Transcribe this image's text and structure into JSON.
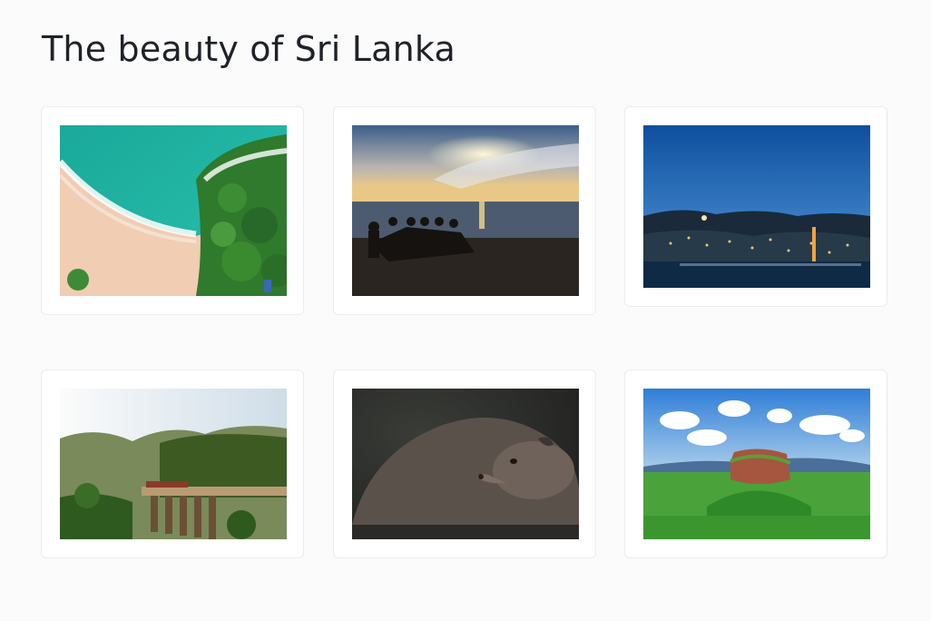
{
  "page": {
    "title": "The beauty of Sri Lanka"
  },
  "gallery": {
    "photos": [
      {
        "subject": "aerial-beach-photo",
        "alt": "Aerial view of turquoise sea and sandy beach"
      },
      {
        "subject": "sunset-fishermen-photo",
        "alt": "Fishermen silhouettes at sunset on beach"
      },
      {
        "subject": "city-night-photo",
        "alt": "City lights by lake at dusk"
      },
      {
        "subject": "nine-arch-bridge-photo",
        "alt": "Stone arch railway bridge in misty forest"
      },
      {
        "subject": "mongoose-photo",
        "alt": "Close-up of a mongoose"
      },
      {
        "subject": "sigiriya-rock-photo",
        "alt": "Sigiriya rock fortress over jungle"
      }
    ]
  }
}
